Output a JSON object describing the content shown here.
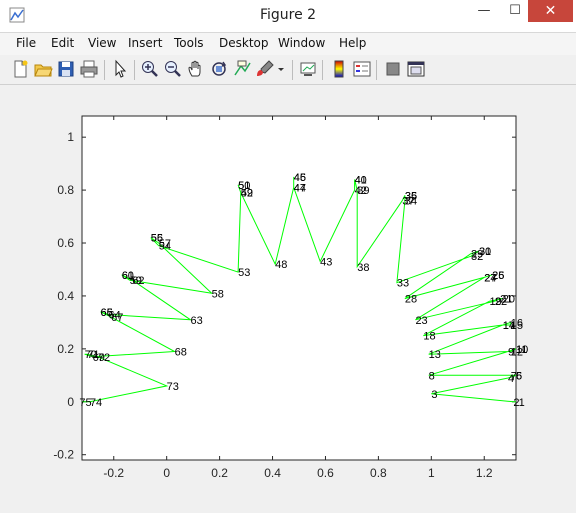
{
  "window": {
    "title": "Figure 2",
    "minimize_glyph": "—",
    "maximize_glyph": "☐",
    "close_glyph": "✕"
  },
  "menu": [
    "File",
    "Edit",
    "View",
    "Insert",
    "Tools",
    "Desktop",
    "Window",
    "Help"
  ],
  "toolbar": [
    "new-figure-icon",
    "open-file-icon",
    "save-icon",
    "print-icon",
    "pointer-icon",
    "zoom-in-icon",
    "zoom-out-icon",
    "pan-icon",
    "rotate-3d-icon",
    "data-cursor-icon",
    "brush-icon",
    "link-plot-icon",
    "colorbar-icon",
    "legend-icon",
    "hide-plot-tools-icon",
    "show-plot-tools-icon"
  ],
  "colors": {
    "line": "#00ff00",
    "axes_bg": "#ffffff",
    "figure_bg": "#f0f0f0",
    "close_button": "#c7463b"
  },
  "chart_data": {
    "type": "line",
    "xlim": [
      -0.32,
      1.32
    ],
    "ylim": [
      -0.22,
      1.08
    ],
    "xticks": [
      -0.2,
      0,
      0.2,
      0.4,
      0.6,
      0.8,
      1,
      1.2
    ],
    "xtick_labels": [
      "-0.2",
      "0",
      "0.2",
      "0.4",
      "0.6",
      "0.8",
      "1",
      "1.2"
    ],
    "yticks": [
      -0.2,
      0,
      0.2,
      0.4,
      0.6,
      0.8,
      1
    ],
    "ytick_labels": [
      "-0.2",
      "0",
      "0.2",
      "0.4",
      "0.6",
      "0.8",
      "1"
    ],
    "grid": false,
    "points": [
      {
        "label": "1",
        "x": 1.33,
        "y": 0.0
      },
      {
        "label": "2",
        "x": 1.31,
        "y": 0.0
      },
      {
        "label": "3",
        "x": 1.0,
        "y": 0.03
      },
      {
        "label": "4",
        "x": 1.29,
        "y": 0.09
      },
      {
        "label": "5",
        "x": 1.32,
        "y": 0.1
      },
      {
        "label": "6",
        "x": 1.32,
        "y": 0.1
      },
      {
        "label": "7",
        "x": 1.3,
        "y": 0.1
      },
      {
        "label": "8",
        "x": 0.99,
        "y": 0.1
      },
      {
        "label": "9",
        "x": 1.29,
        "y": 0.19
      },
      {
        "label": "10",
        "x": 1.32,
        "y": 0.2
      },
      {
        "label": "11",
        "x": 1.32,
        "y": 0.2
      },
      {
        "label": "12",
        "x": 1.3,
        "y": 0.19
      },
      {
        "label": "13",
        "x": 0.99,
        "y": 0.18
      },
      {
        "label": "14",
        "x": 1.27,
        "y": 0.29
      },
      {
        "label": "15",
        "x": 1.3,
        "y": 0.29
      },
      {
        "label": "16",
        "x": 1.3,
        "y": 0.3
      },
      {
        "label": "17",
        "x": 1.27,
        "y": 0.29
      },
      {
        "label": "18",
        "x": 0.97,
        "y": 0.25
      },
      {
        "label": "19",
        "x": 1.22,
        "y": 0.38
      },
      {
        "label": "20",
        "x": 1.27,
        "y": 0.39
      },
      {
        "label": "21",
        "x": 1.26,
        "y": 0.39
      },
      {
        "label": "22",
        "x": 1.24,
        "y": 0.38
      },
      {
        "label": "23",
        "x": 0.94,
        "y": 0.31
      },
      {
        "label": "24",
        "x": 1.2,
        "y": 0.47
      },
      {
        "label": "25",
        "x": 1.23,
        "y": 0.48
      },
      {
        "label": "26",
        "x": 1.23,
        "y": 0.48
      },
      {
        "label": "27",
        "x": 1.2,
        "y": 0.47
      },
      {
        "label": "28",
        "x": 0.9,
        "y": 0.39
      },
      {
        "label": "29",
        "x": 1.15,
        "y": 0.56
      },
      {
        "label": "30",
        "x": 1.18,
        "y": 0.57
      },
      {
        "label": "31",
        "x": 1.18,
        "y": 0.57
      },
      {
        "label": "32",
        "x": 1.15,
        "y": 0.55
      },
      {
        "label": "33",
        "x": 0.87,
        "y": 0.45
      },
      {
        "label": "34",
        "x": 0.9,
        "y": 0.76
      },
      {
        "label": "35",
        "x": 0.9,
        "y": 0.78
      },
      {
        "label": "36",
        "x": 0.9,
        "y": 0.78
      },
      {
        "label": "37",
        "x": 0.89,
        "y": 0.76
      },
      {
        "label": "38",
        "x": 0.72,
        "y": 0.51
      },
      {
        "label": "39",
        "x": 0.72,
        "y": 0.8
      },
      {
        "label": "40",
        "x": 0.71,
        "y": 0.84
      },
      {
        "label": "41",
        "x": 0.71,
        "y": 0.84
      },
      {
        "label": "42",
        "x": 0.71,
        "y": 0.8
      },
      {
        "label": "43",
        "x": 0.58,
        "y": 0.53
      },
      {
        "label": "44",
        "x": 0.48,
        "y": 0.81
      },
      {
        "label": "45",
        "x": 0.48,
        "y": 0.85
      },
      {
        "label": "46",
        "x": 0.48,
        "y": 0.85
      },
      {
        "label": "47",
        "x": 0.48,
        "y": 0.81
      },
      {
        "label": "48",
        "x": 0.41,
        "y": 0.52
      },
      {
        "label": "49",
        "x": 0.28,
        "y": 0.79
      },
      {
        "label": "50",
        "x": 0.27,
        "y": 0.82
      },
      {
        "label": "51",
        "x": 0.27,
        "y": 0.82
      },
      {
        "label": "52",
        "x": 0.28,
        "y": 0.79
      },
      {
        "label": "53",
        "x": 0.27,
        "y": 0.49
      },
      {
        "label": "54",
        "x": -0.03,
        "y": 0.59
      },
      {
        "label": "55",
        "x": -0.06,
        "y": 0.62
      },
      {
        "label": "56",
        "x": -0.06,
        "y": 0.62
      },
      {
        "label": "57",
        "x": -0.03,
        "y": 0.6
      },
      {
        "label": "58",
        "x": 0.17,
        "y": 0.41
      },
      {
        "label": "59",
        "x": -0.14,
        "y": 0.46
      },
      {
        "label": "60",
        "x": -0.17,
        "y": 0.48
      },
      {
        "label": "61",
        "x": -0.17,
        "y": 0.48
      },
      {
        "label": "62",
        "x": -0.13,
        "y": 0.46
      },
      {
        "label": "63",
        "x": 0.09,
        "y": 0.31
      },
      {
        "label": "64",
        "x": -0.22,
        "y": 0.33
      },
      {
        "label": "65",
        "x": -0.25,
        "y": 0.34
      },
      {
        "label": "66",
        "x": -0.25,
        "y": 0.34
      },
      {
        "label": "67",
        "x": -0.21,
        "y": 0.32
      },
      {
        "label": "68",
        "x": 0.03,
        "y": 0.19
      },
      {
        "label": "69",
        "x": -0.28,
        "y": 0.17
      },
      {
        "label": "70",
        "x": -0.31,
        "y": 0.18
      },
      {
        "label": "71",
        "x": -0.3,
        "y": 0.18
      },
      {
        "label": "72",
        "x": -0.26,
        "y": 0.17
      },
      {
        "label": "73",
        "x": 0.0,
        "y": 0.06
      },
      {
        "label": "74",
        "x": -0.29,
        "y": 0.0
      },
      {
        "label": "75",
        "x": -0.33,
        "y": 0.0
      }
    ]
  }
}
